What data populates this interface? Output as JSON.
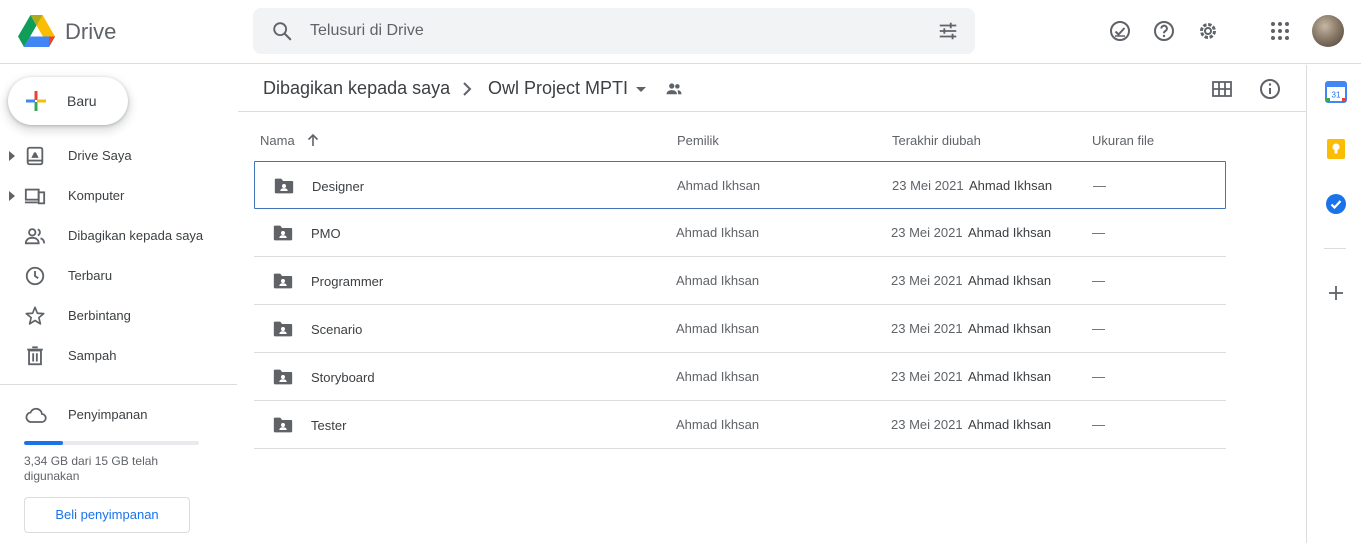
{
  "header": {
    "app_name": "Drive",
    "search_placeholder": "Telusuri di Drive",
    "icons": [
      "search-icon",
      "tune-icon",
      "offline-check-icon",
      "help-icon",
      "settings-icon",
      "apps-grid-icon",
      "avatar"
    ]
  },
  "sidebar": {
    "new_label": "Baru",
    "items": [
      {
        "label": "Drive Saya",
        "icon": "drive-icon",
        "expandable": true
      },
      {
        "label": "Komputer",
        "icon": "computer-icon",
        "expandable": true
      },
      {
        "label": "Dibagikan kepada saya",
        "icon": "shared-people-icon",
        "expandable": false
      },
      {
        "label": "Terbaru",
        "icon": "clock-icon",
        "expandable": false
      },
      {
        "label": "Berbintang",
        "icon": "star-icon",
        "expandable": false
      },
      {
        "label": "Sampah",
        "icon": "trash-icon",
        "expandable": false
      }
    ],
    "storage": {
      "label": "Penyimpanan",
      "used_fraction": 0.223,
      "text": "3,34 GB dari 15 GB telah digunakan",
      "buy_label": "Beli penyimpanan"
    }
  },
  "breadcrumb": {
    "parent": "Dibagikan kepada saya",
    "current": "Owl Project MPTI"
  },
  "table": {
    "headers": {
      "name": "Nama",
      "owner": "Pemilik",
      "modified": "Terakhir diubah",
      "size": "Ukuran file"
    },
    "rows": [
      {
        "name": "Designer",
        "owner": "Ahmad Ikhsan",
        "date": "23 Mei 2021",
        "by": "Ahmad Ikhsan",
        "size": "—"
      },
      {
        "name": "PMO",
        "owner": "Ahmad Ikhsan",
        "date": "23 Mei 2021",
        "by": "Ahmad Ikhsan",
        "size": "—"
      },
      {
        "name": "Programmer",
        "owner": "Ahmad Ikhsan",
        "date": "23 Mei 2021",
        "by": "Ahmad Ikhsan",
        "size": "—"
      },
      {
        "name": "Scenario",
        "owner": "Ahmad Ikhsan",
        "date": "23 Mei 2021",
        "by": "Ahmad Ikhsan",
        "size": "—"
      },
      {
        "name": "Storyboard",
        "owner": "Ahmad Ikhsan",
        "date": "23 Mei 2021",
        "by": "Ahmad Ikhsan",
        "size": "—"
      },
      {
        "name": "Tester",
        "owner": "Ahmad Ikhsan",
        "date": "23 Mei 2021",
        "by": "Ahmad Ikhsan",
        "size": "—"
      }
    ]
  },
  "right_rail": {
    "calendar_day": "31",
    "icons": [
      "calendar-icon",
      "keep-icon",
      "tasks-icon",
      "add-addon-icon"
    ]
  },
  "colors": {
    "accent": "#1a73e8",
    "selected_border": "#4174b8",
    "divider": "#dadce0",
    "search_bg": "#f1f3f4",
    "keep_yellow": "#fbbc04"
  }
}
